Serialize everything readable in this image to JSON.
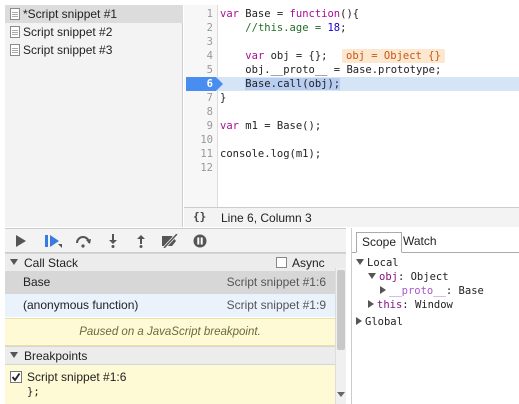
{
  "snippets": {
    "items": [
      {
        "label": "*Script snippet #1",
        "selected": true
      },
      {
        "label": "Script snippet #2",
        "selected": false
      },
      {
        "label": "Script snippet #3",
        "selected": false
      }
    ]
  },
  "editor": {
    "line_numbers": [
      "1",
      "2",
      "3",
      "4",
      "5",
      "6",
      "7",
      "8",
      "9",
      "10",
      "11",
      "12"
    ],
    "line1": {
      "kw1": "var",
      "rest1": " Base = ",
      "kw2": "function",
      "rest2": "(){"
    },
    "line2": {
      "comment": "//this.age = ",
      "num": "18",
      "semi": ";"
    },
    "line4": {
      "kw": "var",
      "rest": " obj = {};"
    },
    "inline_value": "obj = Object {}",
    "line5": "obj.__proto__ = Base.prototype;",
    "line6": "Base.call(obj);",
    "line7": "}",
    "line9": {
      "kw": "var",
      "rest": " m1 = Base();"
    },
    "line11": "console.log(m1);",
    "breakpoint_line": "6"
  },
  "status": {
    "icon": "{}",
    "position": "Line 6, Column 3"
  },
  "debugger": {
    "call_stack_title": "Call Stack",
    "async_label": "Async",
    "call_stack": [
      {
        "fn": "Base",
        "loc": "Script snippet #1:6",
        "selected": true
      },
      {
        "fn": "(anonymous function)",
        "loc": "Script snippet #1:9",
        "selected": false
      }
    ],
    "paused_message": "Paused on a JavaScript breakpoint.",
    "breakpoints_title": "Breakpoints",
    "breakpoint_label": "Script snippet #1:6",
    "breakpoint_code": "};"
  },
  "scope": {
    "tabs": [
      "Scope",
      "Watch"
    ],
    "local_label": "Local",
    "obj_key": "obj",
    "obj_val": ": Object",
    "proto_key": "__proto__",
    "proto_val": ": Base",
    "this_key": "this",
    "this_val": ": Window",
    "global_label": "Global"
  },
  "colors": {
    "keyword": "#aa0d91",
    "comment": "#236e25",
    "number": "#1c00cf",
    "breakpoint": "#4a8df0",
    "paused_bg": "#fffad6"
  }
}
